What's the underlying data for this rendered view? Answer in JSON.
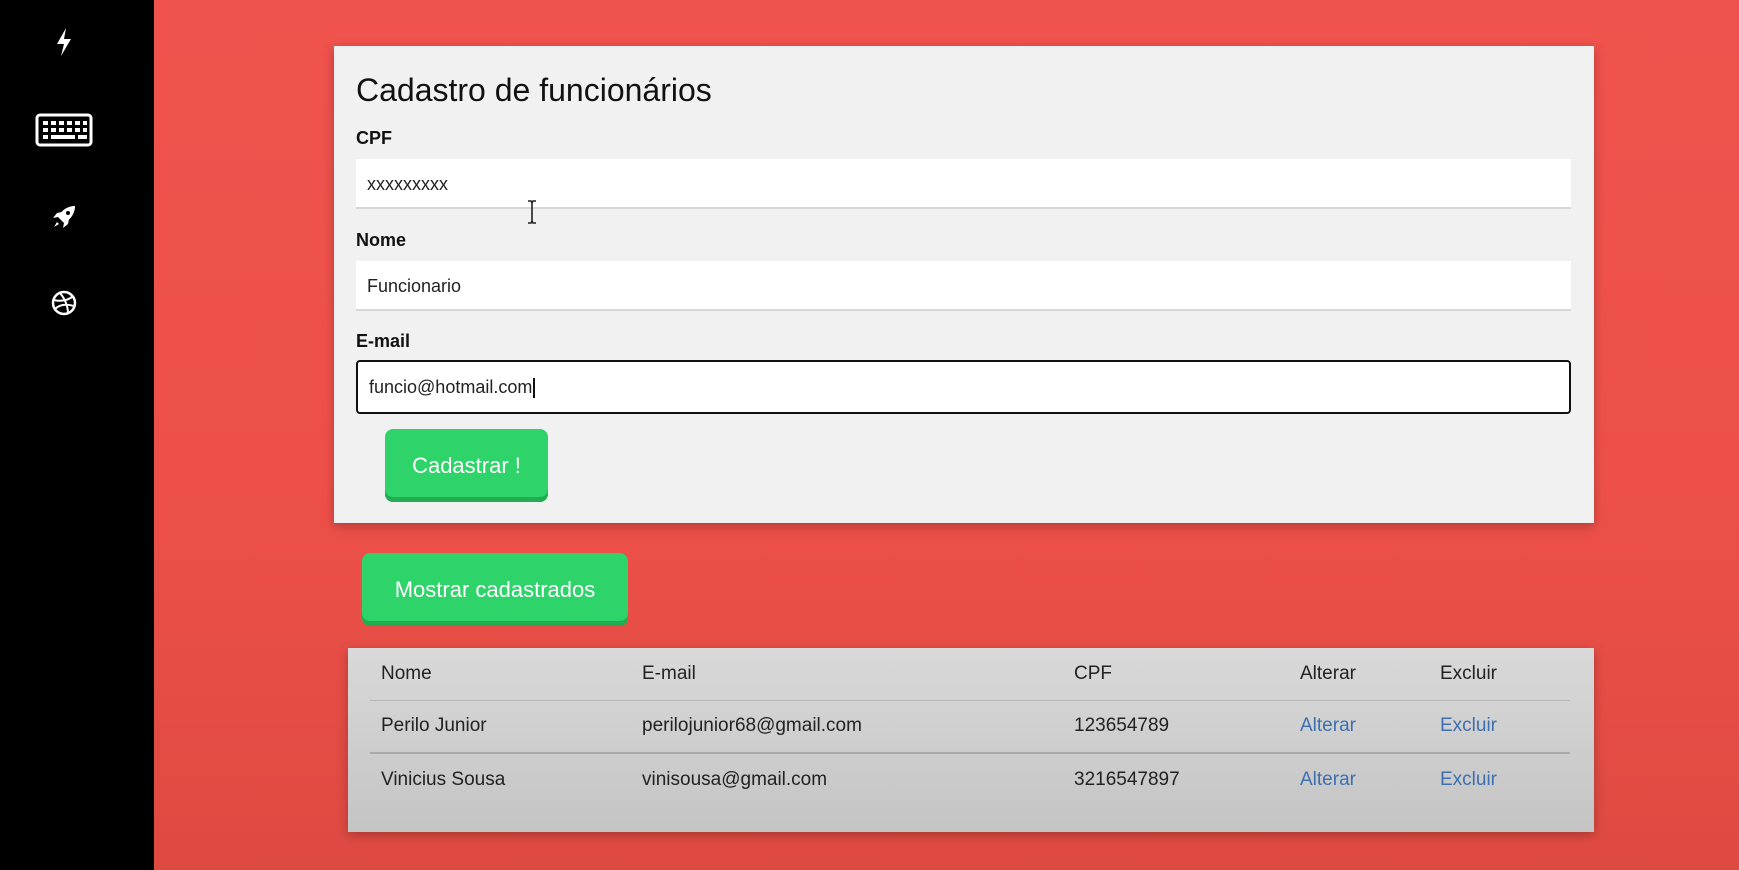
{
  "sidebar": {
    "icons": [
      "lightning-icon",
      "keyboard-icon",
      "rocket-icon",
      "dribbble-ball-icon"
    ]
  },
  "form": {
    "title": "Cadastro de funcionários",
    "cpf": {
      "label": "CPF",
      "value": "xxxxxxxxx"
    },
    "nome": {
      "label": "Nome",
      "value": "Funcionario"
    },
    "email": {
      "label": "E-mail",
      "value": "funcio@hotmail.com"
    },
    "submit_label": "Cadastrar !"
  },
  "show_button_label": "Mostrar cadastrados",
  "table": {
    "headers": [
      "Nome",
      "E-mail",
      "CPF",
      "Alterar",
      "Excluir"
    ],
    "rows": [
      {
        "nome": "Perilo Junior",
        "email": "perilojunior68@gmail.com",
        "cpf": "123654789",
        "alterar": "Alterar",
        "excluir": "Excluir"
      },
      {
        "nome": "Vinicius Sousa",
        "email": "vinisousa@gmail.com",
        "cpf": "3216547897",
        "alterar": "Alterar",
        "excluir": "Excluir"
      }
    ]
  },
  "colors": {
    "background": "#f0524d",
    "sidebar": "#000000",
    "button_green": "#2ed36a",
    "link": "#3d6fb0"
  }
}
